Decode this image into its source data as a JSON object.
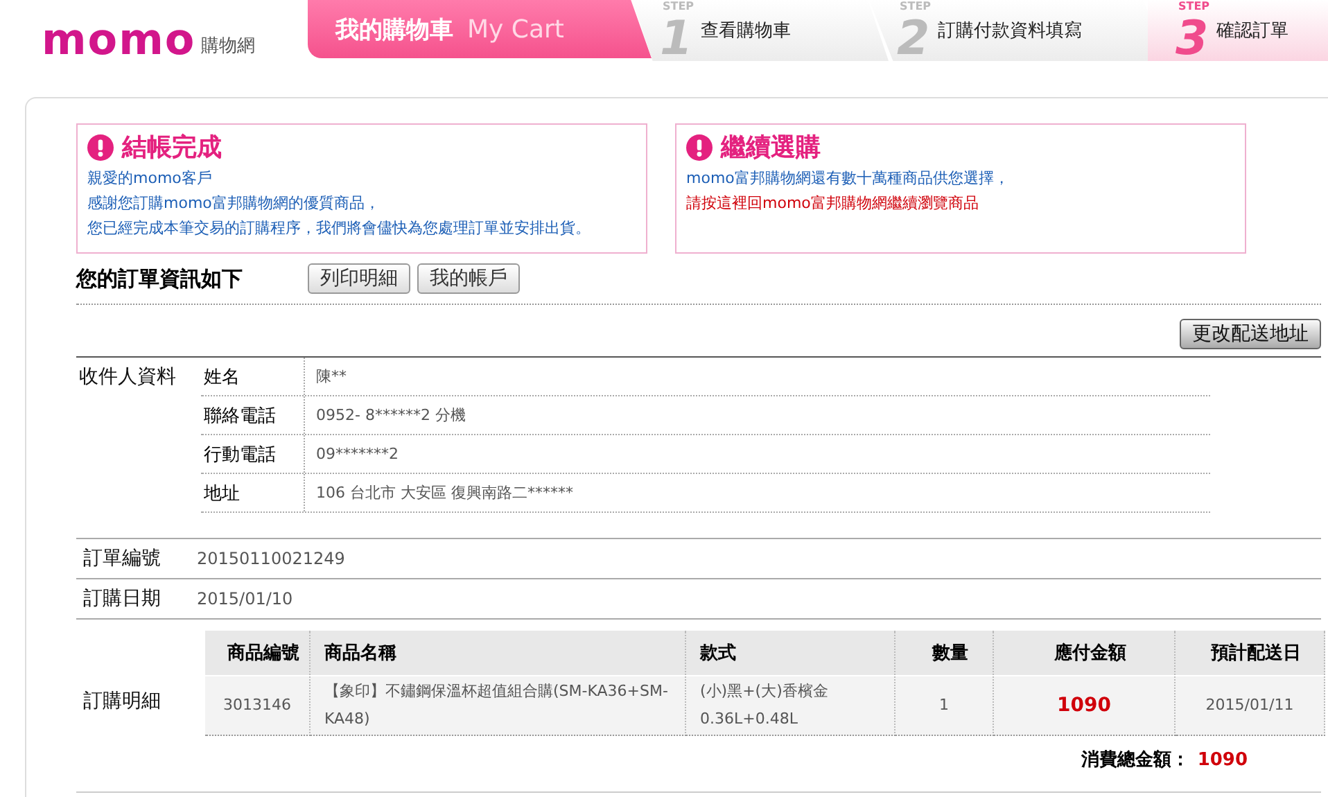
{
  "logo": {
    "brand": "momo",
    "subtitle": "購物網"
  },
  "cart_tab": {
    "title": "我的購物車",
    "subtitle": "My Cart"
  },
  "steps": [
    {
      "tag": "STEP",
      "number": "1",
      "label": "查看購物車",
      "selected": false
    },
    {
      "tag": "STEP",
      "number": "2",
      "label": "訂購付款資料填寫",
      "selected": false
    },
    {
      "tag": "STEP",
      "number": "3",
      "label": "確認訂單",
      "selected": true
    }
  ],
  "notices": [
    {
      "title": "結帳完成",
      "lines": [
        {
          "text": "親愛的momo客戶",
          "kind": "info"
        },
        {
          "text": "感謝您訂購momo富邦購物網的優質商品，",
          "kind": "info"
        },
        {
          "text": "您已經完成本筆交易的訂購程序，我們將會儘快為您處理訂單並安排出貨。",
          "kind": "info"
        }
      ]
    },
    {
      "title": "繼續選購",
      "lines": [
        {
          "text": "momo富邦購物網還有數十萬種商品供您選擇，",
          "kind": "info"
        },
        {
          "text": "請按這裡回momo富邦購物網繼續瀏覽商品",
          "kind": "link"
        }
      ]
    }
  ],
  "order_heading": "您的訂單資訊如下",
  "order_buttons": [
    "列印明細",
    "我的帳戶"
  ],
  "change_address_button": "更改配送地址",
  "recipient": {
    "label": "收件人資料",
    "fields": [
      {
        "label": "姓名",
        "value": "陳**"
      },
      {
        "label": "聯絡電話",
        "value": "0952- 8******2 分機"
      },
      {
        "label": "行動電話",
        "value": "09*******2"
      },
      {
        "label": "地址",
        "value": "106 台北市 大安區 復興南路二******"
      }
    ]
  },
  "order_number": {
    "label": "訂單編號",
    "value": "20150110021249"
  },
  "order_date": {
    "label": "訂購日期",
    "value": "2015/01/10"
  },
  "details": {
    "label": "訂購明細",
    "columns": [
      "商品編號",
      "商品名稱",
      "款式",
      "數量",
      "應付金額",
      "預計配送日"
    ],
    "rows": [
      [
        "3013146",
        "【象印】不鏽鋼保溫杯超值組合購(SM-KA36+SM-KA48)",
        "(小)黑+(大)香檳金 0.36L+0.48L",
        "1",
        "1090",
        "2015/01/11"
      ]
    ],
    "total_label": "消費總金額：",
    "total": "1090"
  }
}
